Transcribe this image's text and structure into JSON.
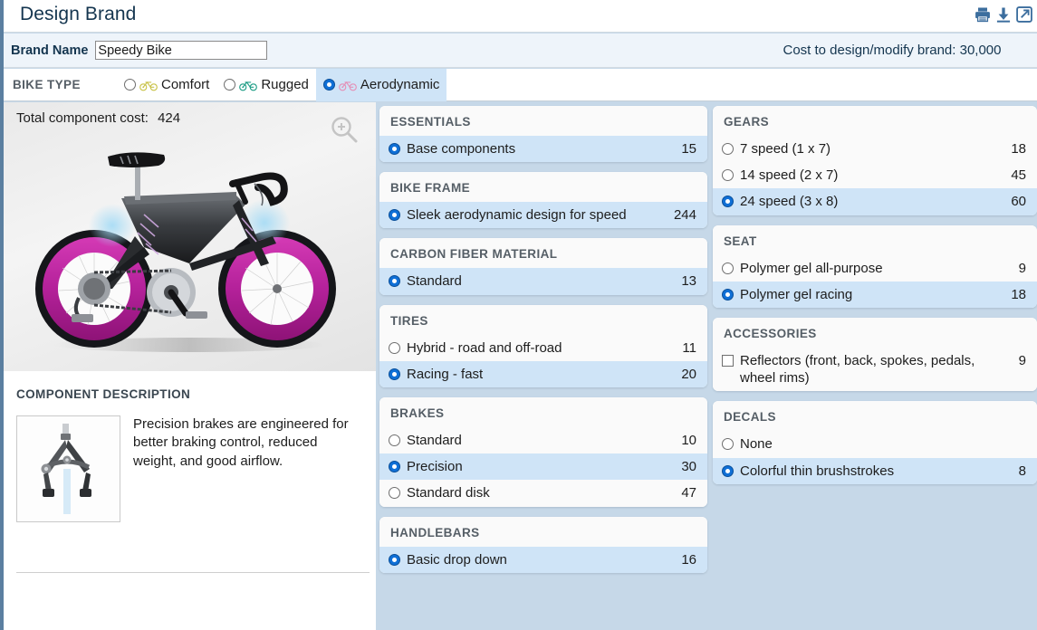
{
  "header": {
    "title": "Design Brand",
    "icons": [
      {
        "name": "print-icon",
        "label": "Print"
      },
      {
        "name": "download-icon",
        "label": "Download"
      },
      {
        "name": "open-in-new-icon",
        "label": "Open in new window"
      }
    ]
  },
  "brand_row": {
    "label": "Brand Name",
    "value": "Speedy Bike",
    "placeholder": "",
    "cost_text": "Cost to design/modify brand: 30,000"
  },
  "bike_type": {
    "label": "BIKE TYPE",
    "options": [
      {
        "label": "Comfort",
        "selected": false,
        "icon": "bike-icon",
        "icon_color": "#c9c34a"
      },
      {
        "label": "Rugged",
        "selected": false,
        "icon": "bike-icon",
        "icon_color": "#1f9e86"
      },
      {
        "label": "Aerodynamic",
        "selected": true,
        "icon": "bike-icon",
        "icon_color": "#e491b8"
      }
    ]
  },
  "preview": {
    "total_cost_label": "Total component cost:",
    "total_cost_value": "424",
    "zoom_icon": "zoom-in-icon"
  },
  "description": {
    "heading": "COMPONENT DESCRIPTION",
    "thumb_icon": "brake-caliper-image",
    "text": "Precision brakes are engineered for better braking control, reduced weight, and good airflow."
  },
  "colors": {
    "accent": "#0f6fd6",
    "selected_row": "#cfe4f7",
    "page_bg": "#c6d8e8",
    "title_text": "#14354f"
  },
  "columns": {
    "middle": [
      {
        "title": "ESSENTIALS",
        "options": [
          {
            "label": "Base components",
            "price": "15",
            "selected": true,
            "control": "radio"
          }
        ]
      },
      {
        "title": "BIKE FRAME",
        "options": [
          {
            "label": "Sleek aerodynamic design for speed",
            "price": "244",
            "selected": true,
            "control": "radio"
          }
        ]
      },
      {
        "title": "CARBON FIBER MATERIAL",
        "options": [
          {
            "label": "Standard",
            "price": "13",
            "selected": true,
            "control": "radio"
          }
        ]
      },
      {
        "title": "TIRES",
        "options": [
          {
            "label": "Hybrid - road and off-road",
            "price": "11",
            "selected": false,
            "control": "radio"
          },
          {
            "label": "Racing - fast",
            "price": "20",
            "selected": true,
            "control": "radio"
          }
        ]
      },
      {
        "title": "BRAKES",
        "options": [
          {
            "label": "Standard",
            "price": "10",
            "selected": false,
            "control": "radio"
          },
          {
            "label": "Precision",
            "price": "30",
            "selected": true,
            "control": "radio"
          },
          {
            "label": "Standard disk",
            "price": "47",
            "selected": false,
            "control": "radio"
          }
        ]
      },
      {
        "title": "HANDLEBARS",
        "options": [
          {
            "label": "Basic drop down",
            "price": "16",
            "selected": true,
            "control": "radio"
          }
        ]
      }
    ],
    "right": [
      {
        "title": "GEARS",
        "options": [
          {
            "label": "7 speed (1 x 7)",
            "price": "18",
            "selected": false,
            "control": "radio"
          },
          {
            "label": "14 speed (2 x 7)",
            "price": "45",
            "selected": false,
            "control": "radio"
          },
          {
            "label": "24 speed (3 x 8)",
            "price": "60",
            "selected": true,
            "control": "radio"
          }
        ]
      },
      {
        "title": "SEAT",
        "options": [
          {
            "label": "Polymer gel all-purpose",
            "price": "9",
            "selected": false,
            "control": "radio"
          },
          {
            "label": "Polymer gel racing",
            "price": "18",
            "selected": true,
            "control": "radio"
          }
        ]
      },
      {
        "title": "ACCESSORIES",
        "options": [
          {
            "label": "Reflectors (front, back, spokes, pedals, wheel rims)",
            "price": "9",
            "selected": false,
            "control": "checkbox"
          }
        ]
      },
      {
        "title": "DECALS",
        "options": [
          {
            "label": "None",
            "price": "",
            "selected": false,
            "control": "radio"
          },
          {
            "label": "Colorful thin brushstrokes",
            "price": "8",
            "selected": true,
            "control": "radio"
          }
        ]
      }
    ]
  }
}
